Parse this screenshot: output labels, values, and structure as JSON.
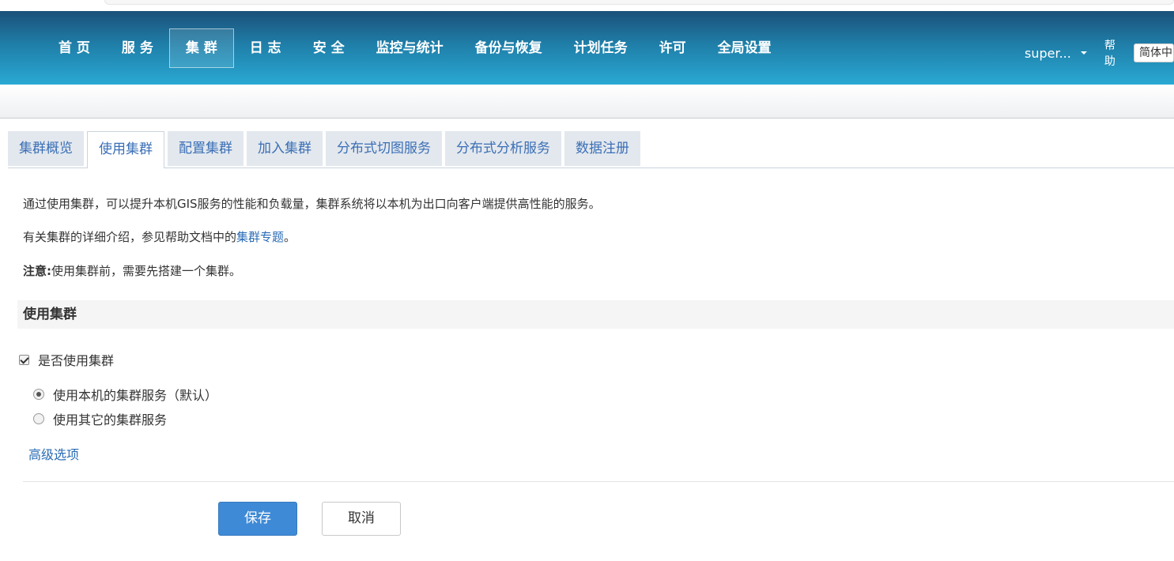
{
  "nav": {
    "items": [
      {
        "label": "首 页",
        "active": false
      },
      {
        "label": "服 务",
        "active": false
      },
      {
        "label": "集 群",
        "active": true
      },
      {
        "label": "日 志",
        "active": false
      },
      {
        "label": "安 全",
        "active": false
      },
      {
        "label": "监控与统计",
        "active": false
      },
      {
        "label": "备份与恢复",
        "active": false
      },
      {
        "label": "计划任务",
        "active": false
      },
      {
        "label": "许可",
        "active": false
      },
      {
        "label": "全局设置",
        "active": false
      }
    ]
  },
  "user": {
    "name": "super...",
    "help_label": "帮助",
    "language": "简体中"
  },
  "tabs": [
    {
      "label": "集群概览",
      "active": false
    },
    {
      "label": "使用集群",
      "active": true
    },
    {
      "label": "配置集群",
      "active": false
    },
    {
      "label": "加入集群",
      "active": false
    },
    {
      "label": "分布式切图服务",
      "active": false
    },
    {
      "label": "分布式分析服务",
      "active": false
    },
    {
      "label": "数据注册",
      "active": false
    }
  ],
  "intro": {
    "line1": "通过使用集群，可以提升本机GIS服务的性能和负载量，集群系统将以本机为出口向客户端提供高性能的服务。",
    "line2_prefix": "有关集群的详细介绍，参见帮助文档中的",
    "line2_link": "集群专题",
    "line2_suffix": "。",
    "note_label": "注意:",
    "note_text": "使用集群前，需要先搭建一个集群。"
  },
  "section": {
    "title": "使用集群",
    "use_cluster_label": "是否使用集群",
    "use_cluster_checked": true,
    "options": [
      {
        "label": "使用本机的集群服务（默认）",
        "selected": true
      },
      {
        "label": "使用其它的集群服务",
        "selected": false
      }
    ],
    "advanced_label": "高级选项"
  },
  "actions": {
    "save_label": "保存",
    "cancel_label": "取消"
  },
  "colors": {
    "header_dark": "#1b5079",
    "header_light": "#29a9d3",
    "link": "#2a6cb5",
    "primary_button": "#3f8ad6"
  }
}
